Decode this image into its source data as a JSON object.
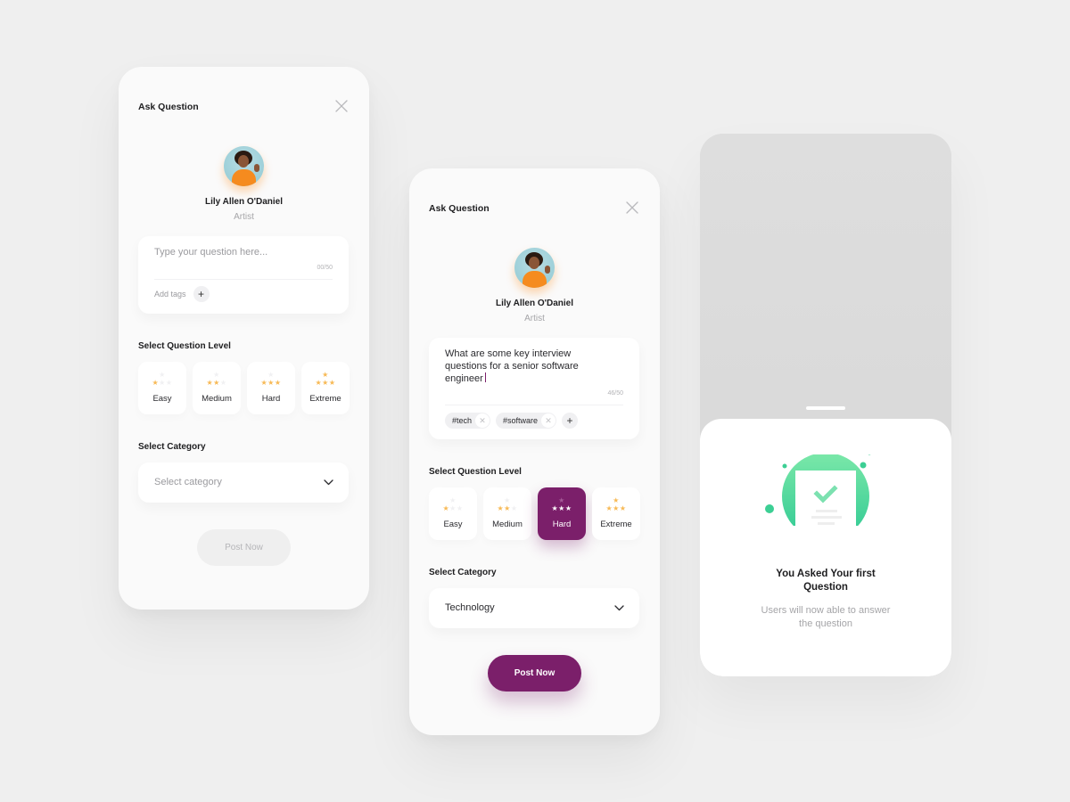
{
  "colors": {
    "accent": "#7b1f6a",
    "star": "#f7b955",
    "success": "#3ccf94",
    "background": "#efefef"
  },
  "screens": [
    {
      "title": "Ask Question",
      "close_icon": "close-icon",
      "user": {
        "name": "Lily Allen O'Daniel",
        "role": "Artist"
      },
      "question": {
        "placeholder": "Type your question here...",
        "value": "",
        "count": "00/50",
        "add_tags_label": "Add tags",
        "tags": []
      },
      "level_section_label": "Select Question Level",
      "levels": [
        {
          "name": "Easy",
          "stars_filled": 1,
          "stars_total": 4,
          "selected": false
        },
        {
          "name": "Medium",
          "stars_filled": 2,
          "stars_total": 4,
          "selected": false
        },
        {
          "name": "Hard",
          "stars_filled": 3,
          "stars_total": 4,
          "selected": false
        },
        {
          "name": "Extreme",
          "stars_filled": 4,
          "stars_total": 4,
          "selected": false
        }
      ],
      "category_section_label": "Select Category",
      "category": {
        "placeholder": "Select category",
        "value": ""
      },
      "post_button": {
        "label": "Post Now",
        "enabled": false
      }
    },
    {
      "title": "Ask Question",
      "close_icon": "close-icon",
      "user": {
        "name": "Lily Allen O'Daniel",
        "role": "Artist"
      },
      "question": {
        "placeholder": "",
        "value": "What are some key interview questions for a senior software engineer",
        "count": "46/50",
        "add_tags_label": "",
        "tags": [
          "#tech",
          "#software"
        ]
      },
      "level_section_label": "Select Question Level",
      "levels": [
        {
          "name": "Easy",
          "stars_filled": 1,
          "stars_total": 4,
          "selected": false
        },
        {
          "name": "Medium",
          "stars_filled": 2,
          "stars_total": 4,
          "selected": false
        },
        {
          "name": "Hard",
          "stars_filled": 3,
          "stars_total": 4,
          "selected": true
        },
        {
          "name": "Extreme",
          "stars_filled": 4,
          "stars_total": 4,
          "selected": false
        }
      ],
      "category_section_label": "Select Category",
      "category": {
        "placeholder": "",
        "value": "Technology"
      },
      "post_button": {
        "label": "Post Now",
        "enabled": true
      }
    },
    {
      "success": {
        "icon": "document-check-icon",
        "title_line1": "You Asked Your first",
        "title_line2": "Question",
        "subtitle_line1": "Users will now able to answer",
        "subtitle_line2": "the question"
      }
    }
  ]
}
